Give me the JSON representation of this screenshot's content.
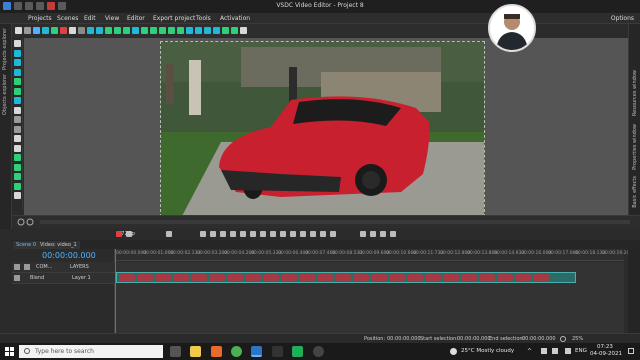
{
  "window": {
    "title": "VSDC Video Editor - Project 8"
  },
  "menu": {
    "items": [
      "Projects",
      "Scenes",
      "Edit",
      "View",
      "Editor",
      "Export project",
      "Tools",
      "Activation"
    ],
    "options": "Options"
  },
  "left_tabs": {
    "projects_explorer": "Projects explorer",
    "objects_explorer": "Objects explorer"
  },
  "right_tabs": {
    "resources_window": "Resources window",
    "properties_window": "Properties window",
    "basic_effects": "Basic effects"
  },
  "playback": {
    "zoom_label": "720p"
  },
  "scenes": {
    "tabs": [
      "Scene 0",
      "Video: video_1"
    ]
  },
  "timeline": {
    "timecode": "00:00:00.000",
    "ruler_ticks": [
      "00:00:00.000",
      "00:00:01.066",
      "00:00:02.133",
      "00:00:03.200",
      "00:00:04.266",
      "00:00:05.333",
      "00:00:06.400",
      "00:00:07.466",
      "00:00:08.533",
      "00:00:09.600",
      "00:00:10.666",
      "00:00:11.733",
      "00:00:12.800",
      "00:00:13.866",
      "00:00:14.933",
      "00:00:16.000",
      "00:00:17.066",
      "00:00:18.133",
      "00:00:19.200"
    ],
    "layers_header": {
      "com": "COM...",
      "label": "LAYERS"
    },
    "layer_row": {
      "blend": "Blend",
      "name": "Layer 1"
    }
  },
  "status": {
    "position_label": "Position:",
    "position_value": "00:00:00.000",
    "start_sel_label": "Start selection:",
    "start_sel_value": "00:00:00.000",
    "end_sel_label": "End selection:",
    "end_sel_value": "00:00:00.000",
    "zoom": "25%"
  },
  "taskbar": {
    "search_placeholder": "Type here to search",
    "weather": "25°C  Mostly cloudy",
    "lang": "ENG",
    "time": "07:23",
    "date": "04-09-2021"
  }
}
